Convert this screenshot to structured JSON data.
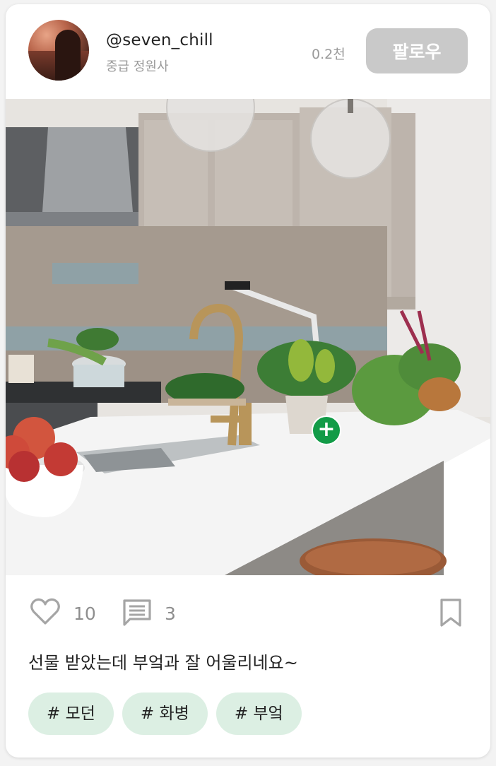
{
  "header": {
    "username": "@seven_chill",
    "user_level": "중급 정원사",
    "follower_count": "0.2천",
    "follow_label": "팔로우"
  },
  "photo": {
    "hotspot_label": "+"
  },
  "actions": {
    "like_count": "10",
    "comment_count": "3"
  },
  "caption": "선물 받았는데 부엌과 잘 어울리네요~",
  "tags": [
    {
      "label": "# 모던"
    },
    {
      "label": "# 화병"
    },
    {
      "label": "# 부엌"
    }
  ],
  "colors": {
    "accent_green": "#129b47",
    "tag_background": "#dcefe3",
    "follow_button": "#c9c9c9",
    "muted_text": "#9a9a9a"
  },
  "icons": [
    "heart-icon",
    "comment-icon",
    "bookmark-icon",
    "add-icon"
  ]
}
